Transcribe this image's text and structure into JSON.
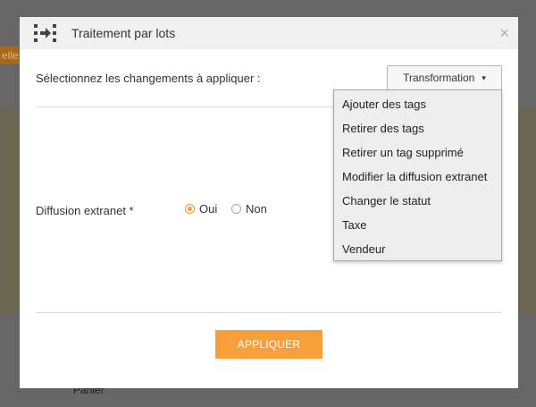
{
  "background": {
    "partial_label": "elle",
    "bottom_text": "Panier"
  },
  "modal": {
    "icon": "batch-process-icon",
    "title": "Traitement par lots",
    "close_label": "×",
    "select_label": "Sélectionnez les changements à appliquer :",
    "transform_button": "Transformation",
    "transform_caret": "▾",
    "diffusion_label": "Diffusion extranet *",
    "radio_options": [
      {
        "label": "Oui",
        "checked": true
      },
      {
        "label": "Non",
        "checked": false
      }
    ],
    "apply_button": "APPLIQUER"
  },
  "dropdown": {
    "items": [
      "Ajouter des tags",
      "Retirer des tags",
      "Retirer un tag supprimé",
      "Modifier la diffusion extranet",
      "Changer le statut",
      "Taxe",
      "Vendeur"
    ]
  },
  "colors": {
    "accent": "#f7a03b",
    "radio_selected": "#f39c2f",
    "overlay": "#5d5d5d",
    "header_bg": "#f0f0f0"
  }
}
